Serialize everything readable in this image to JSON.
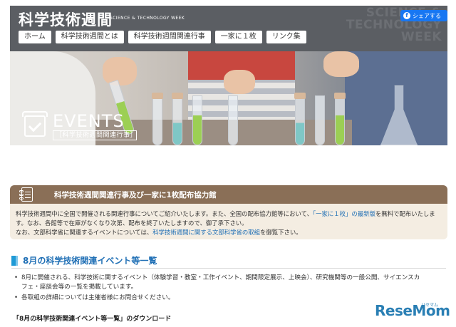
{
  "header": {
    "site_title": "科学技術週間",
    "site_subtitle": "SCIENCE & TECHNOLOGY WEEK",
    "bg_title_lines": [
      "SCIENCE &",
      "TECHNOLOGY",
      "WEEK"
    ],
    "share_label": "シェアする",
    "share_icon": "facebook-icon",
    "nav": [
      "ホーム",
      "科学技術週間とは",
      "科学技術週間関連行事",
      "一家に１枚",
      "リンク集"
    ]
  },
  "hero": {
    "title": "EVENTS",
    "subtitle": "［科学技術週間関連行事］",
    "icon": "clipboard-check-icon"
  },
  "info": {
    "title": "科学技術週間関連行事及び一家に1枚配布協力館",
    "icon": "document-icon",
    "line1_pre": "科学技術週間中に全国で開催される関連行事についてご紹介いたします。また、全国の配布協力館等において、",
    "line1_link": "「一家に１枚」の最新版",
    "line1_post": "を無料で配布いたしま",
    "line2": "す。なお、各館等で在庫がなくなり次第、配布を終了いたしますので、御了承下さい。",
    "line3_pre": "なお、文部科学省に関連するイベントについては、",
    "line3_link": "科学技術週間に関する文部科学省の取組",
    "line3_post": "を御覧下さい。"
  },
  "august": {
    "title": "8月の科学技術関連イベント等一覧",
    "bullet1_line1": "8月に開催される、科学技術に関するイベント（体験学習・教室・工作イベント、期間限定展示、上映会）、研究機関等の一般公開、サイエンスカ",
    "bullet1_line2": "フェ・座談会等の一覧を掲載しています。",
    "bullet2": "各取組の詳細については主催者様にお問合せください。",
    "download_label": "「8月の科学技術関連イベント等一覧」のダウンロード"
  },
  "watermark": {
    "text": "ReseMom",
    "small": "リセマム"
  }
}
